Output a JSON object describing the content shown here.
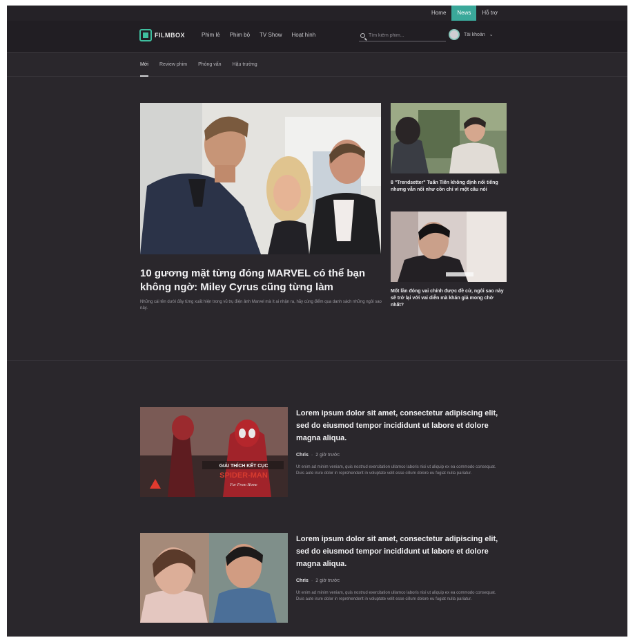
{
  "utilbar": {
    "links": [
      "Home",
      "News",
      "Hỗ trợ"
    ]
  },
  "header": {
    "logo_text": "FILMBOX",
    "nav": [
      "Phim lẻ",
      "Phim bộ",
      "TV Show",
      "Hoạt hình"
    ],
    "search_placeholder": "Tìm kiếm phim...",
    "user_name": "Tài khoản"
  },
  "subnav": [
    "Mới",
    "Review phim",
    "Phỏng vấn",
    "Hậu trường"
  ],
  "hero": {
    "title": "10 gương mặt từng đóng MARVEL có thể bạn không ngờ: Miley Cyrus cũng từng làm",
    "description": "Những cái tên dưới đây từng xuất hiện trong vũ trụ điện ảnh Marvel mà ít ai nhận ra, hãy cùng điểm qua danh sách những ngôi sao này."
  },
  "side_articles": [
    {
      "title": "8 \"Trendsetter\" Tuấn Tiến không định nổi tiếng nhưng vẫn nổi như cồn chỉ vì một câu nói"
    },
    {
      "title": "Mốt lần đóng vai chính được đề cử, ngôi sao này sẽ trở lại với vai diễn mà khán giả mong chờ nhất?"
    }
  ],
  "articles": [
    {
      "title": "Lorem ipsum dolor sit amet, consectetur adipiscing elit, sed do eiusmod tempor incididunt ut labore et dolore magna aliqua.",
      "author": "Chris",
      "time": "2 giờ trước",
      "excerpt": "Ut enim ad minim veniam, quis nostrud exercitation ullamco laboris nisi ut aliquip ex ea commodo consequat. Duis aute irure dolor in reprehenderit in voluptate velit esse cillum dolore eu fugiat nulla pariatur."
    },
    {
      "title": "Lorem ipsum dolor sit amet, consectetur adipiscing elit, sed do eiusmod tempor incididunt ut labore et dolore magna aliqua.",
      "author": "Chris",
      "time": "2 giờ trước",
      "excerpt": "Ut enim ad minim veniam, quis nostrud exercitation ullamco laboris nisi ut aliquip ex ea commodo consequat. Duis aute irure dolor in reprehenderit in voluptate velit esse cillum dolore eu fugiat nulla pariatur."
    }
  ],
  "colors": {
    "background": "#2a272c",
    "header": "#211e23",
    "accent": "#3aa89a"
  }
}
